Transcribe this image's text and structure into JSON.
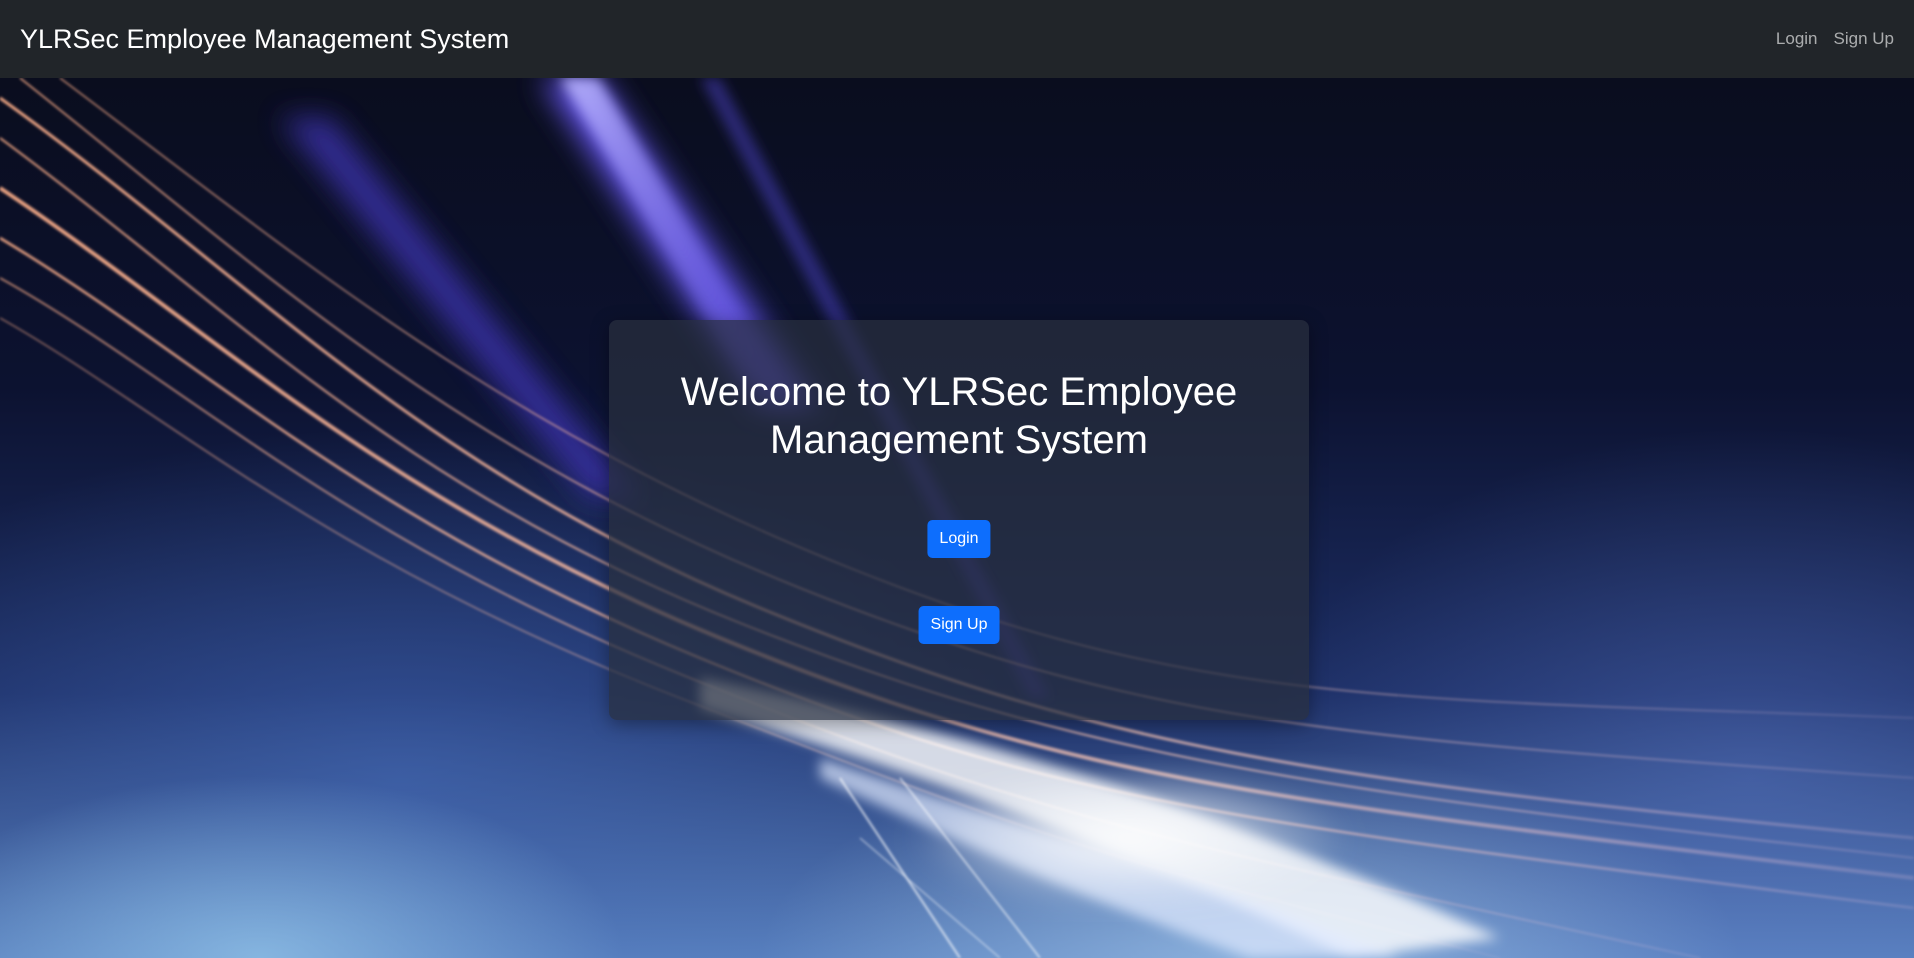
{
  "navbar": {
    "brand": "YLRSec Employee Management System",
    "links": [
      {
        "label": "Login"
      },
      {
        "label": "Sign Up"
      }
    ]
  },
  "hero": {
    "title": "Welcome to YLRSec Employee Management System",
    "buttons": {
      "login": "Login",
      "signup": "Sign Up"
    }
  },
  "colors": {
    "navbar_bg": "#212529",
    "primary_button": "#0d6efd",
    "card_bg": "#282f3e"
  }
}
